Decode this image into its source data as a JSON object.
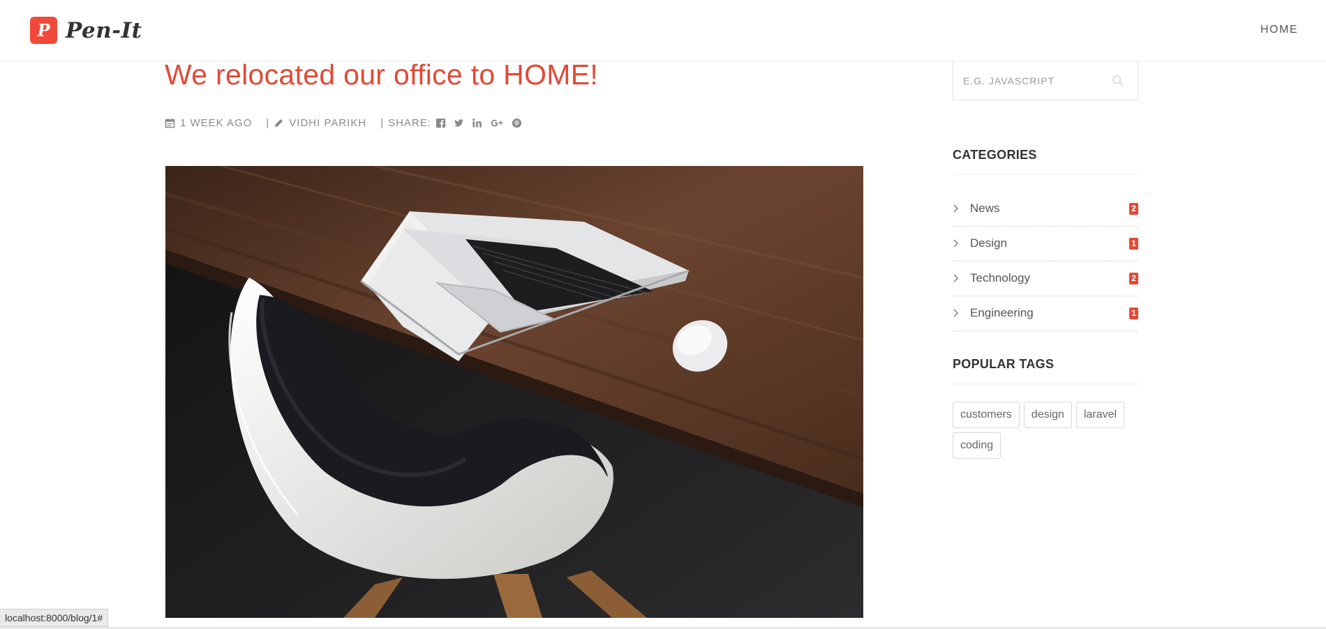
{
  "brand": {
    "mark": "P",
    "name": "Pen-It",
    "accent": "#f0493a"
  },
  "nav": {
    "home_label": "HOME"
  },
  "post": {
    "title": "We relocated our office to HOME!",
    "date": "1 WEEK AGO",
    "author": "VIDHI PARIKH",
    "share_label": "SHARE:",
    "share_icons": [
      "facebook-icon",
      "twitter-icon",
      "linkedin-icon",
      "google-plus-icon",
      "pinterest-icon"
    ],
    "title_color": "#e04a36"
  },
  "sidebar": {
    "search": {
      "placeholder": "E.G. JAVASCRIPT"
    },
    "categories_title": "CATEGORIES",
    "categories": [
      {
        "name": "News",
        "count": "2"
      },
      {
        "name": "Design",
        "count": "1"
      },
      {
        "name": "Technology",
        "count": "2"
      },
      {
        "name": "Engineering",
        "count": "1"
      }
    ],
    "tags_title": "POPULAR TAGS",
    "tags": [
      "customers",
      "design",
      "laravel",
      "coding"
    ]
  },
  "statusbar": {
    "url": "localhost:8000/blog/1#"
  }
}
